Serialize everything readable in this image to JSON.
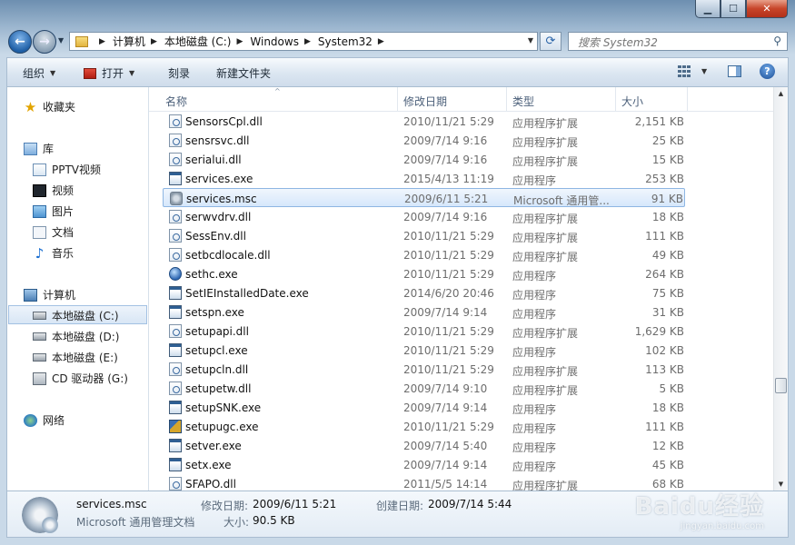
{
  "address": {
    "crumbs": [
      "计算机",
      "本地磁盘 (C:)",
      "Windows",
      "System32"
    ]
  },
  "search": {
    "placeholder": "搜索 System32"
  },
  "toolbar": {
    "organize": "组织",
    "open": "打开",
    "burn": "刻录",
    "new_folder": "新建文件夹"
  },
  "nav": {
    "favorites": "收藏夹",
    "libraries": "库",
    "lib_items": [
      "PPTV视频",
      "视频",
      "图片",
      "文档",
      "音乐"
    ],
    "computer": "计算机",
    "drives": [
      "本地磁盘 (C:)",
      "本地磁盘 (D:)",
      "本地磁盘 (E:)",
      "CD 驱动器 (G:)"
    ],
    "network": "网络"
  },
  "columns": {
    "name": "名称",
    "date": "修改日期",
    "type": "类型",
    "size": "大小"
  },
  "files": [
    {
      "name": "SensorsCpl.dll",
      "date": "2010/11/21 5:29",
      "type": "应用程序扩展",
      "size": "2,151 KB",
      "icon": "dll"
    },
    {
      "name": "sensrsvc.dll",
      "date": "2009/7/14 9:16",
      "type": "应用程序扩展",
      "size": "25 KB",
      "icon": "dll"
    },
    {
      "name": "serialui.dll",
      "date": "2009/7/14 9:16",
      "type": "应用程序扩展",
      "size": "15 KB",
      "icon": "dll"
    },
    {
      "name": "services.exe",
      "date": "2015/4/13 11:19",
      "type": "应用程序",
      "size": "253 KB",
      "icon": "exe"
    },
    {
      "name": "services.msc",
      "date": "2009/6/11 5:21",
      "type": "Microsoft 通用管...",
      "size": "91 KB",
      "icon": "msc",
      "selected": true
    },
    {
      "name": "serwvdrv.dll",
      "date": "2009/7/14 9:16",
      "type": "应用程序扩展",
      "size": "18 KB",
      "icon": "dll"
    },
    {
      "name": "SessEnv.dll",
      "date": "2010/11/21 5:29",
      "type": "应用程序扩展",
      "size": "111 KB",
      "icon": "dll"
    },
    {
      "name": "setbcdlocale.dll",
      "date": "2010/11/21 5:29",
      "type": "应用程序扩展",
      "size": "49 KB",
      "icon": "dll"
    },
    {
      "name": "sethc.exe",
      "date": "2010/11/21 5:29",
      "type": "应用程序",
      "size": "264 KB",
      "icon": "globe"
    },
    {
      "name": "SetIEInstalledDate.exe",
      "date": "2014/6/20 20:46",
      "type": "应用程序",
      "size": "75 KB",
      "icon": "exe"
    },
    {
      "name": "setspn.exe",
      "date": "2009/7/14 9:14",
      "type": "应用程序",
      "size": "31 KB",
      "icon": "exe"
    },
    {
      "name": "setupapi.dll",
      "date": "2010/11/21 5:29",
      "type": "应用程序扩展",
      "size": "1,629 KB",
      "icon": "dll"
    },
    {
      "name": "setupcl.exe",
      "date": "2010/11/21 5:29",
      "type": "应用程序",
      "size": "102 KB",
      "icon": "exe"
    },
    {
      "name": "setupcln.dll",
      "date": "2010/11/21 5:29",
      "type": "应用程序扩展",
      "size": "113 KB",
      "icon": "dll"
    },
    {
      "name": "setupetw.dll",
      "date": "2009/7/14 9:10",
      "type": "应用程序扩展",
      "size": "5 KB",
      "icon": "dll"
    },
    {
      "name": "setupSNK.exe",
      "date": "2009/7/14 9:14",
      "type": "应用程序",
      "size": "18 KB",
      "icon": "exe"
    },
    {
      "name": "setupugc.exe",
      "date": "2010/11/21 5:29",
      "type": "应用程序",
      "size": "111 KB",
      "icon": "setup"
    },
    {
      "name": "setver.exe",
      "date": "2009/7/14 5:40",
      "type": "应用程序",
      "size": "12 KB",
      "icon": "exe"
    },
    {
      "name": "setx.exe",
      "date": "2009/7/14 9:14",
      "type": "应用程序",
      "size": "45 KB",
      "icon": "exe"
    },
    {
      "name": "SFAPO.dll",
      "date": "2011/5/5 14:14",
      "type": "应用程序扩展",
      "size": "68 KB",
      "icon": "dll"
    }
  ],
  "details": {
    "name": "services.msc",
    "type": "Microsoft 通用管理文档",
    "modified_label": "修改日期:",
    "modified_value": "2009/6/11 5:21",
    "created_label": "创建日期:",
    "created_value": "2009/7/14 5:44",
    "size_label": "大小:",
    "size_value": "90.5 KB"
  },
  "watermark": {
    "brand": "Baidu经验",
    "url": "jingyan.baidu.com"
  }
}
